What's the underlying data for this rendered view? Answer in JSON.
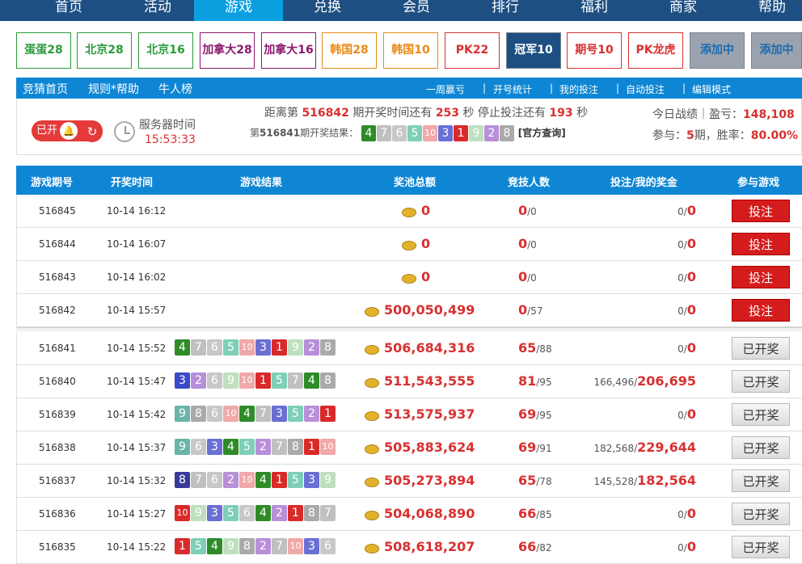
{
  "topnav": [
    "首页",
    "活动",
    "游戏",
    "兑换",
    "会员",
    "排行",
    "福利",
    "商家",
    "帮助"
  ],
  "tabs": [
    {
      "label": "蛋蛋28",
      "color": "#2a9b3a",
      "bg": "#fff"
    },
    {
      "label": "北京28",
      "color": "#2a9b3a",
      "bg": "#fff"
    },
    {
      "label": "北京16",
      "color": "#2a9b3a",
      "bg": "#fff"
    },
    {
      "label": "加拿大28",
      "color": "#8b1a6e",
      "bg": "#fff"
    },
    {
      "label": "加拿大16",
      "color": "#8b1a6e",
      "bg": "#fff"
    },
    {
      "label": "韩国28",
      "color": "#e88a1a",
      "bg": "#fff"
    },
    {
      "label": "韩国10",
      "color": "#e88a1a",
      "bg": "#fff"
    },
    {
      "label": "PK22",
      "color": "#d93030",
      "bg": "#fff"
    },
    {
      "label": "冠军10",
      "color": "#fff",
      "bg": "#1d4f83"
    },
    {
      "label": "期号10",
      "color": "#d93030",
      "bg": "#fff"
    },
    {
      "label": "PK龙虎",
      "color": "#d93030",
      "bg": "#fff"
    },
    {
      "label": "添加中",
      "color": "#1d6ab0",
      "bg": "#9aa3ad"
    },
    {
      "label": "添加中",
      "color": "#1d6ab0",
      "bg": "#9aa3ad"
    }
  ],
  "subnav": {
    "left": [
      "竞猜首页",
      "规则*帮助",
      "牛人榜"
    ],
    "right": [
      "一周赢亏",
      "开号统计",
      "我的投注",
      "自动投注",
      "编辑模式"
    ]
  },
  "info": {
    "pill": "已开",
    "server_label": "服务器时间",
    "server_time": "15:53:33",
    "countdown_pre": "距离第",
    "countdown_issue": "516842",
    "countdown_mid": "期开奖时间还有",
    "countdown_secs": "253",
    "countdown_mid2": "秒 停止投注还有",
    "countdown_stop": "193",
    "countdown_end": "秒",
    "last_pre": "第",
    "last_issue": "516841",
    "last_mid": "期开奖结果：",
    "last_balls": [
      "4",
      "7",
      "6",
      "5",
      "10",
      "3",
      "1",
      "9",
      "2",
      "8"
    ],
    "official": "[官方查询]",
    "stats_label": "今日战绩｜盈亏：",
    "stats_profit": "148,108",
    "stats_join_pre": "参与：",
    "stats_join": "5",
    "stats_join_mid": "期，胜率：",
    "stats_rate": "80.00%"
  },
  "table": {
    "headers": [
      "游戏期号",
      "开奖时间",
      "游戏结果",
      "奖池总额",
      "竞技人数",
      "投注/我的奖金",
      "参与游戏"
    ],
    "rows": [
      {
        "issue": "516845",
        "time": "10-14 16:12",
        "balls": [],
        "pool": "0",
        "players": "0",
        "total": "/0",
        "bet": "0/",
        "prize": "0",
        "action": "投注",
        "state": "open"
      },
      {
        "issue": "516844",
        "time": "10-14 16:07",
        "balls": [],
        "pool": "0",
        "players": "0",
        "total": "/0",
        "bet": "0/",
        "prize": "0",
        "action": "投注",
        "state": "open"
      },
      {
        "issue": "516843",
        "time": "10-14 16:02",
        "balls": [],
        "pool": "0",
        "players": "0",
        "total": "/0",
        "bet": "0/",
        "prize": "0",
        "action": "投注",
        "state": "open"
      },
      {
        "issue": "516842",
        "time": "10-14 15:57",
        "balls": [],
        "pool": "500,050,499",
        "players": "0",
        "total": "/57",
        "bet": "0/",
        "prize": "0",
        "action": "投注",
        "state": "open"
      },
      {
        "issue": "516841",
        "time": "10-14 15:52",
        "balls": [
          "4",
          "7",
          "6",
          "5",
          "10",
          "3",
          "1",
          "9",
          "2",
          "8"
        ],
        "pool": "506,684,316",
        "players": "65",
        "total": "/88",
        "bet": "0/",
        "prize": "0",
        "action": "已开奖",
        "state": "done"
      },
      {
        "issue": "516840",
        "time": "10-14 15:47",
        "balls": [
          "3",
          "2",
          "6",
          "9",
          "10",
          "1",
          "5",
          "7",
          "4",
          "8"
        ],
        "pool": "511,543,555",
        "players": "81",
        "total": "/95",
        "bet": "166,496/",
        "prize": "206,695",
        "action": "已开奖",
        "state": "done"
      },
      {
        "issue": "516839",
        "time": "10-14 15:42",
        "balls": [
          "9",
          "8",
          "6",
          "10",
          "4",
          "7",
          "3",
          "5",
          "2",
          "1"
        ],
        "pool": "513,575,937",
        "players": "69",
        "total": "/95",
        "bet": "0/",
        "prize": "0",
        "action": "已开奖",
        "state": "done"
      },
      {
        "issue": "516838",
        "time": "10-14 15:37",
        "balls": [
          "9",
          "6",
          "3",
          "4",
          "5",
          "2",
          "7",
          "8",
          "1",
          "10"
        ],
        "pool": "505,883,624",
        "players": "69",
        "total": "/91",
        "bet": "182,568/",
        "prize": "229,644",
        "action": "已开奖",
        "state": "done"
      },
      {
        "issue": "516837",
        "time": "10-14 15:32",
        "balls": [
          "8",
          "7",
          "6",
          "2",
          "10",
          "4",
          "1",
          "5",
          "3",
          "9"
        ],
        "pool": "505,273,894",
        "players": "65",
        "total": "/78",
        "bet": "145,528/",
        "prize": "182,564",
        "action": "已开奖",
        "state": "done"
      },
      {
        "issue": "516836",
        "time": "10-14 15:27",
        "balls": [
          "10",
          "9",
          "3",
          "5",
          "6",
          "4",
          "2",
          "1",
          "8",
          "7"
        ],
        "pool": "504,068,890",
        "players": "66",
        "total": "/85",
        "bet": "0/",
        "prize": "0",
        "action": "已开奖",
        "state": "done"
      },
      {
        "issue": "516835",
        "time": "10-14 15:22",
        "balls": [
          "1",
          "5",
          "4",
          "9",
          "8",
          "2",
          "7",
          "10",
          "3",
          "6"
        ],
        "pool": "508,618,207",
        "players": "66",
        "total": "/82",
        "bet": "0/",
        "prize": "0",
        "action": "已开奖",
        "state": "done"
      }
    ]
  },
  "ball_colors": {
    "1": "#d92a2a",
    "2": "#b88fd8",
    "3": "#6a6fd4",
    "4": "#2e8b28",
    "5": "#7fcfb8",
    "6": "#c8c8c8",
    "7": "#c0c0c0",
    "8": "#aaaaaa",
    "9": "#bfe0bf",
    "10": "#f0a8a8"
  },
  "first_ball_colors": {
    "1": "#d92a2a",
    "3": "#3949c8",
    "4": "#2e8b28",
    "8": "#3a3a9a",
    "9": "#6bb4a8",
    "10": "#d92a2a"
  }
}
